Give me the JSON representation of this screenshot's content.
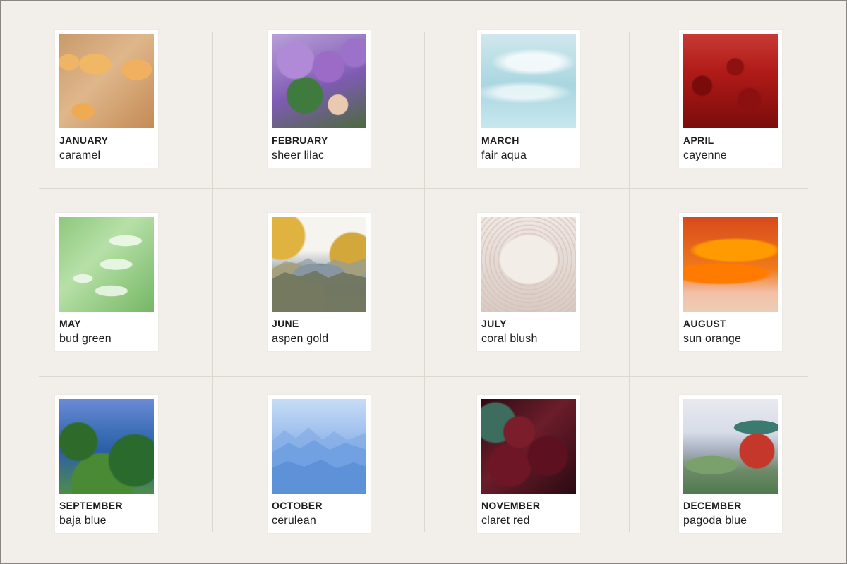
{
  "cards": [
    {
      "month": "JANUARY",
      "name": "caramel",
      "photo_icon": "caramel-squares-photo"
    },
    {
      "month": "FEBRUARY",
      "name": "sheer lilac",
      "photo_icon": "lilac-bouquet-photo"
    },
    {
      "month": "MARCH",
      "name": "fair aqua",
      "photo_icon": "water-surface-photo"
    },
    {
      "month": "APRIL",
      "name": "cayenne",
      "photo_icon": "dried-chilies-photo"
    },
    {
      "month": "MAY",
      "name": "bud green",
      "photo_icon": "green-buds-photo"
    },
    {
      "month": "JUNE",
      "name": "aspen gold",
      "photo_icon": "aspen-mountains-photo"
    },
    {
      "month": "JULY",
      "name": "coral blush",
      "photo_icon": "brain-coral-photo"
    },
    {
      "month": "AUGUST",
      "name": "sun orange",
      "photo_icon": "orange-sunset-photo"
    },
    {
      "month": "SEPTEMBER",
      "name": "baja blue",
      "photo_icon": "palm-ocean-photo"
    },
    {
      "month": "OCTOBER",
      "name": "cerulean",
      "photo_icon": "blue-mountains-photo"
    },
    {
      "month": "NOVEMBER",
      "name": "claret red",
      "photo_icon": "rose-tea-photo"
    },
    {
      "month": "DECEMBER",
      "name": "pagoda blue",
      "photo_icon": "pagoda-photo"
    }
  ],
  "colors": {
    "background": "#f2efea",
    "grid_line": "#ddd7cf",
    "card": "#ffffff",
    "text": "#1e1e1e"
  }
}
